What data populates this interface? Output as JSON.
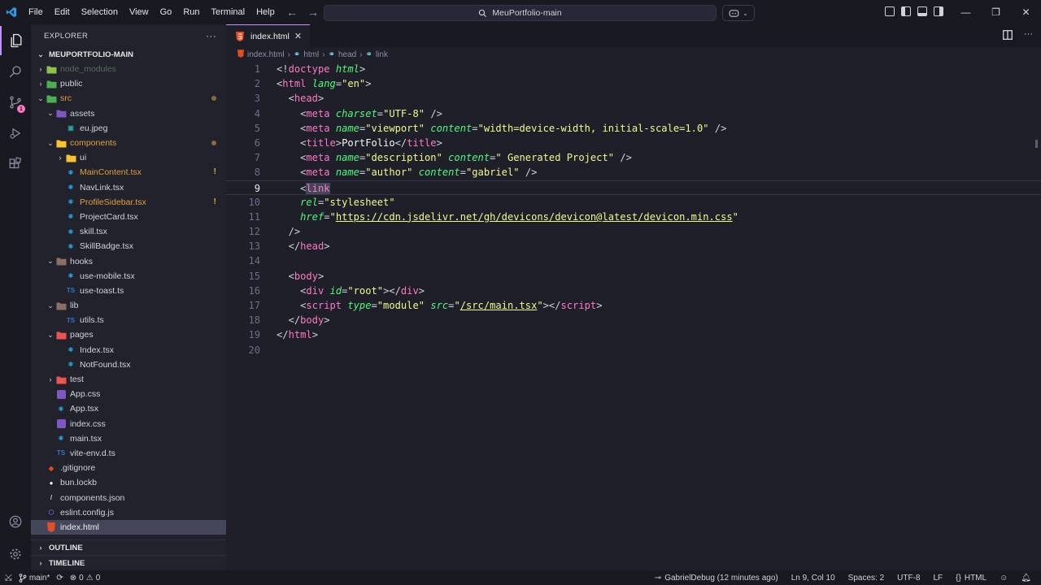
{
  "titlebar": {
    "menu": [
      "File",
      "Edit",
      "Selection",
      "View",
      "Go",
      "Run",
      "Terminal",
      "Help"
    ],
    "search_text": "MeuPortfolio-main"
  },
  "activity_bar": {
    "items": [
      "explorer-icon",
      "search-icon",
      "source-control-icon",
      "run-debug-icon",
      "extensions-icon"
    ],
    "scm_badge": "1",
    "bottom": [
      "account-icon",
      "settings-gear-icon"
    ]
  },
  "explorer": {
    "header": "EXPLORER",
    "more": "···",
    "root": "MEUPORTFOLIO-MAIN",
    "outline_label": "OUTLINE",
    "timeline_label": "TIMELINE",
    "tree": [
      {
        "label": "node_modules",
        "depth": 1,
        "kind": "folder",
        "open": false,
        "color": "#6b8f6b",
        "icon_color": "#8bc34a",
        "dim": true
      },
      {
        "label": "public",
        "depth": 1,
        "kind": "folder",
        "open": false,
        "color": "#cfd3dc",
        "icon_color": "#4caf50"
      },
      {
        "label": "src",
        "depth": 1,
        "kind": "folder",
        "open": true,
        "color": "#e2a23b",
        "icon_color": "#4caf50",
        "mark": "dot"
      },
      {
        "label": "assets",
        "depth": 2,
        "kind": "folder",
        "open": true,
        "color": "#cfd3dc",
        "icon_color": "#7e57c2"
      },
      {
        "label": "eu.jpeg",
        "depth": 3,
        "kind": "image",
        "color": "#cfd3dc",
        "icon_color": "#26a69a"
      },
      {
        "label": "components",
        "depth": 2,
        "kind": "folder",
        "open": true,
        "color": "#e2a23b",
        "icon_color": "#fbc02d",
        "mark": "dot"
      },
      {
        "label": "ui",
        "depth": 3,
        "kind": "folder",
        "open": false,
        "color": "#cfd3dc",
        "icon_color": "#fbc02d"
      },
      {
        "label": "MainContent.tsx",
        "depth": 3,
        "kind": "react",
        "color": "#e2a23b",
        "icon_color": "#29b6f6",
        "mark": "bang"
      },
      {
        "label": "NavLink.tsx",
        "depth": 3,
        "kind": "react",
        "color": "#cfd3dc",
        "icon_color": "#29b6f6"
      },
      {
        "label": "ProfileSidebar.tsx",
        "depth": 3,
        "kind": "react",
        "color": "#e2a23b",
        "icon_color": "#29b6f6",
        "mark": "bang"
      },
      {
        "label": "ProjectCard.tsx",
        "depth": 3,
        "kind": "react",
        "color": "#cfd3dc",
        "icon_color": "#29b6f6"
      },
      {
        "label": "skill.tsx",
        "depth": 3,
        "kind": "react",
        "color": "#cfd3dc",
        "icon_color": "#29b6f6"
      },
      {
        "label": "SkillBadge.tsx",
        "depth": 3,
        "kind": "react",
        "color": "#cfd3dc",
        "icon_color": "#29b6f6"
      },
      {
        "label": "hooks",
        "depth": 2,
        "kind": "folder",
        "open": true,
        "color": "#cfd3dc",
        "icon_color": "#8d6e63"
      },
      {
        "label": "use-mobile.tsx",
        "depth": 3,
        "kind": "react",
        "color": "#cfd3dc",
        "icon_color": "#29b6f6"
      },
      {
        "label": "use-toast.ts",
        "depth": 3,
        "kind": "ts",
        "color": "#cfd3dc",
        "icon_color": "#3178c6"
      },
      {
        "label": "lib",
        "depth": 2,
        "kind": "folder",
        "open": true,
        "color": "#cfd3dc",
        "icon_color": "#8d6e63"
      },
      {
        "label": "utils.ts",
        "depth": 3,
        "kind": "ts",
        "color": "#cfd3dc",
        "icon_color": "#3178c6"
      },
      {
        "label": "pages",
        "depth": 2,
        "kind": "folder",
        "open": true,
        "color": "#cfd3dc",
        "icon_color": "#ef5350"
      },
      {
        "label": "Index.tsx",
        "depth": 3,
        "kind": "react",
        "color": "#cfd3dc",
        "icon_color": "#29b6f6"
      },
      {
        "label": "NotFound.tsx",
        "depth": 3,
        "kind": "react",
        "color": "#cfd3dc",
        "icon_color": "#29b6f6"
      },
      {
        "label": "test",
        "depth": 2,
        "kind": "folder",
        "open": false,
        "color": "#cfd3dc",
        "icon_color": "#ef5350"
      },
      {
        "label": "App.css",
        "depth": 2,
        "kind": "css",
        "color": "#cfd3dc",
        "icon_color": "#7e57c2"
      },
      {
        "label": "App.tsx",
        "depth": 2,
        "kind": "react",
        "color": "#cfd3dc",
        "icon_color": "#29b6f6"
      },
      {
        "label": "index.css",
        "depth": 2,
        "kind": "css",
        "color": "#cfd3dc",
        "icon_color": "#7e57c2"
      },
      {
        "label": "main.tsx",
        "depth": 2,
        "kind": "react",
        "color": "#cfd3dc",
        "icon_color": "#29b6f6"
      },
      {
        "label": "vite-env.d.ts",
        "depth": 2,
        "kind": "ts",
        "color": "#cfd3dc",
        "icon_color": "#3178c6"
      },
      {
        "label": ".gitignore",
        "depth": 1,
        "kind": "git",
        "color": "#cfd3dc",
        "icon_color": "#e64a19"
      },
      {
        "label": "bun.lockb",
        "depth": 1,
        "kind": "bun",
        "color": "#cfd3dc",
        "icon_color": "#f0f0f0"
      },
      {
        "label": "components.json",
        "depth": 1,
        "kind": "slash",
        "color": "#cfd3dc",
        "icon_color": "#cfd3dc"
      },
      {
        "label": "eslint.config.js",
        "depth": 1,
        "kind": "eslint",
        "color": "#cfd3dc",
        "icon_color": "#7e57c2"
      },
      {
        "label": "index.html",
        "depth": 1,
        "kind": "html",
        "color": "#f0f0f0",
        "icon_color": "#e44d26",
        "selected": true
      }
    ]
  },
  "editor": {
    "tab_label": "index.html",
    "breadcrumb": [
      "index.html",
      "html",
      "head",
      "link"
    ],
    "current_line": 9,
    "lines": [
      [
        [
          "pn",
          "<!"
        ],
        [
          "tg",
          "doctype"
        ],
        [
          "pl",
          " "
        ],
        [
          "at",
          "html"
        ],
        [
          "pn",
          ">"
        ]
      ],
      [
        [
          "pn",
          "<"
        ],
        [
          "tg",
          "html"
        ],
        [
          "pl",
          " "
        ],
        [
          "at",
          "lang"
        ],
        [
          "pn",
          "="
        ],
        [
          "st",
          "\"en\""
        ],
        [
          "pn",
          ">"
        ]
      ],
      [
        [
          "pl",
          "  "
        ],
        [
          "pn",
          "<"
        ],
        [
          "tg",
          "head"
        ],
        [
          "pn",
          ">"
        ]
      ],
      [
        [
          "pl",
          "    "
        ],
        [
          "pn",
          "<"
        ],
        [
          "tg",
          "meta"
        ],
        [
          "pl",
          " "
        ],
        [
          "at",
          "charset"
        ],
        [
          "pn",
          "="
        ],
        [
          "st",
          "\"UTF-8\""
        ],
        [
          "pl",
          " "
        ],
        [
          "pn",
          "/>"
        ]
      ],
      [
        [
          "pl",
          "    "
        ],
        [
          "pn",
          "<"
        ],
        [
          "tg",
          "meta"
        ],
        [
          "pl",
          " "
        ],
        [
          "at",
          "name"
        ],
        [
          "pn",
          "="
        ],
        [
          "st",
          "\"viewport\""
        ],
        [
          "pl",
          " "
        ],
        [
          "at",
          "content"
        ],
        [
          "pn",
          "="
        ],
        [
          "st",
          "\"width=device-width, initial-scale=1.0\""
        ],
        [
          "pl",
          " "
        ],
        [
          "pn",
          "/>"
        ]
      ],
      [
        [
          "pl",
          "    "
        ],
        [
          "pn",
          "<"
        ],
        [
          "tg",
          "title"
        ],
        [
          "pn",
          ">"
        ],
        [
          "pl",
          "PortFolio"
        ],
        [
          "pn",
          "</"
        ],
        [
          "tg",
          "title"
        ],
        [
          "pn",
          ">"
        ]
      ],
      [
        [
          "pl",
          "    "
        ],
        [
          "pn",
          "<"
        ],
        [
          "tg",
          "meta"
        ],
        [
          "pl",
          " "
        ],
        [
          "at",
          "name"
        ],
        [
          "pn",
          "="
        ],
        [
          "st",
          "\"description\""
        ],
        [
          "pl",
          " "
        ],
        [
          "at",
          "content"
        ],
        [
          "pn",
          "="
        ],
        [
          "st",
          "\" Generated Project\""
        ],
        [
          "pl",
          " "
        ],
        [
          "pn",
          "/>"
        ]
      ],
      [
        [
          "pl",
          "    "
        ],
        [
          "pn",
          "<"
        ],
        [
          "tg",
          "meta"
        ],
        [
          "pl",
          " "
        ],
        [
          "at",
          "name"
        ],
        [
          "pn",
          "="
        ],
        [
          "st",
          "\"author\""
        ],
        [
          "pl",
          " "
        ],
        [
          "at",
          "content"
        ],
        [
          "pn",
          "="
        ],
        [
          "st",
          "\"gabriel\""
        ],
        [
          "pl",
          " "
        ],
        [
          "pn",
          "/>"
        ]
      ],
      [
        [
          "pl",
          "    "
        ],
        [
          "pn",
          "<"
        ],
        [
          "tg",
          "link"
        ]
      ],
      [
        [
          "pl",
          "    "
        ],
        [
          "at",
          "rel"
        ],
        [
          "pn",
          "="
        ],
        [
          "st",
          "\"stylesheet\""
        ]
      ],
      [
        [
          "pl",
          "    "
        ],
        [
          "at",
          "href"
        ],
        [
          "pn",
          "="
        ],
        [
          "st",
          "\""
        ],
        [
          "stul",
          "https://cdn.jsdelivr.net/gh/devicons/devicon@latest/devicon.min.css"
        ],
        [
          "st",
          "\""
        ]
      ],
      [
        [
          "pl",
          "  "
        ],
        [
          "pn",
          "/>"
        ]
      ],
      [
        [
          "pl",
          "  "
        ],
        [
          "pn",
          "</"
        ],
        [
          "tg",
          "head"
        ],
        [
          "pn",
          ">"
        ]
      ],
      [],
      [
        [
          "pl",
          "  "
        ],
        [
          "pn",
          "<"
        ],
        [
          "tg",
          "body"
        ],
        [
          "pn",
          ">"
        ]
      ],
      [
        [
          "pl",
          "    "
        ],
        [
          "pn",
          "<"
        ],
        [
          "tg",
          "div"
        ],
        [
          "pl",
          " "
        ],
        [
          "at",
          "id"
        ],
        [
          "pn",
          "="
        ],
        [
          "st",
          "\"root\""
        ],
        [
          "pn",
          "></"
        ],
        [
          "tg",
          "div"
        ],
        [
          "pn",
          ">"
        ]
      ],
      [
        [
          "pl",
          "    "
        ],
        [
          "pn",
          "<"
        ],
        [
          "tg",
          "script"
        ],
        [
          "pl",
          " "
        ],
        [
          "at",
          "type"
        ],
        [
          "pn",
          "="
        ],
        [
          "st",
          "\"module\""
        ],
        [
          "pl",
          " "
        ],
        [
          "at",
          "src"
        ],
        [
          "pn",
          "="
        ],
        [
          "st",
          "\""
        ],
        [
          "stul",
          "/src/main.tsx"
        ],
        [
          "st",
          "\""
        ],
        [
          "pn",
          "></"
        ],
        [
          "tg",
          "script"
        ],
        [
          "pn",
          ">"
        ]
      ],
      [
        [
          "pl",
          "  "
        ],
        [
          "pn",
          "</"
        ],
        [
          "tg",
          "body"
        ],
        [
          "pn",
          ">"
        ]
      ],
      [
        [
          "pn",
          "</"
        ],
        [
          "tg",
          "html"
        ],
        [
          "pn",
          ">"
        ]
      ],
      []
    ]
  },
  "statusbar": {
    "branch": "main*",
    "problems": "0",
    "warnings": "0",
    "blame": "GabrielDebug (12 minutes ago)",
    "position": "Ln 9, Col 10",
    "spaces": "Spaces: 2",
    "encoding": "UTF-8",
    "eol": "LF",
    "language": "HTML"
  },
  "colors": {
    "accent": "#bd93f9",
    "tag": "#ff79c6",
    "attribute": "#50fa7b",
    "string": "#f1fa8c"
  }
}
